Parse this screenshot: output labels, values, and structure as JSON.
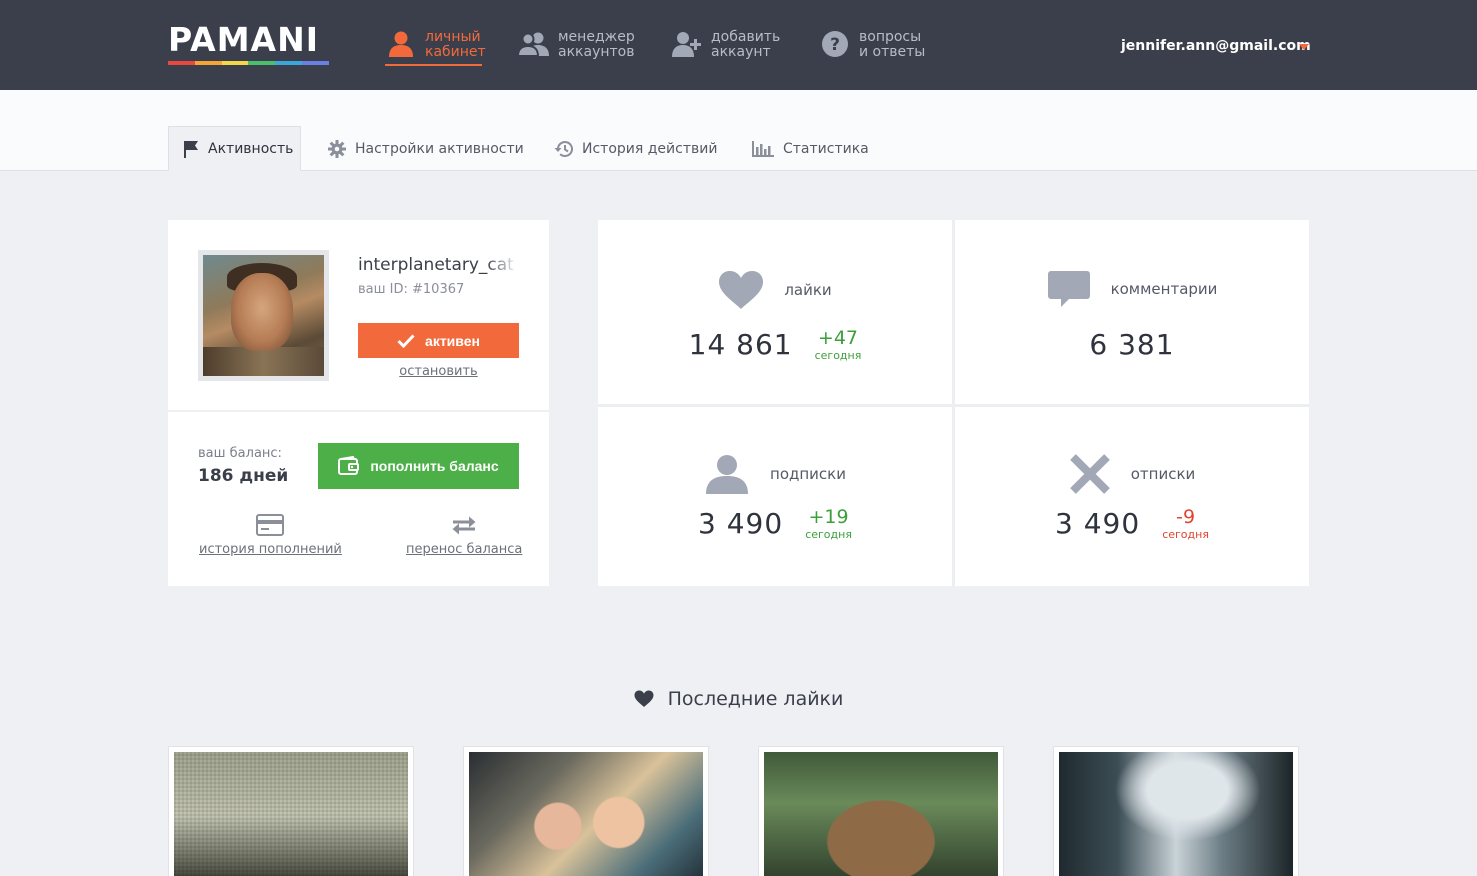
{
  "header": {
    "logo": "PAMANI",
    "logo_colors": [
      "#e9483f",
      "#f4a533",
      "#f5d84a",
      "#4cbf6a",
      "#3aa6d9",
      "#6c7ee1"
    ],
    "nav": [
      {
        "line1": "личный",
        "line2": "кабинет",
        "icon": "user-icon",
        "active": true
      },
      {
        "line1": "менеджер",
        "line2": "аккаунтов",
        "icon": "users-icon",
        "active": false
      },
      {
        "line1": "добавить",
        "line2": "аккаунт",
        "icon": "add-user-icon",
        "active": false
      },
      {
        "line1": "вопросы",
        "line2": "и ответы",
        "icon": "question-icon",
        "active": false
      }
    ],
    "user_email": "jennifer.ann@gmail.com",
    "accent": "#f26a3c",
    "bg": "#3b3f4b"
  },
  "tabs": [
    {
      "label": "Активность",
      "icon": "flag-icon",
      "active": true
    },
    {
      "label": "Настройки активности",
      "icon": "gear-icon",
      "active": false
    },
    {
      "label": "История действий",
      "icon": "history-icon",
      "active": false
    },
    {
      "label": "Статистика",
      "icon": "bar-chart-icon",
      "active": false
    }
  ],
  "profile": {
    "username": "interplanetary_cat",
    "user_id": "ваш ID: #10367",
    "status_button": "активен",
    "stop_link": "остановить",
    "balance_label": "ваш баланс:",
    "balance_value": "186 дней",
    "topup_button": "пополнить баланс",
    "history_link": "история пополнений",
    "transfer_link": "перенос баланса"
  },
  "stats": {
    "likes": {
      "label": "лайки",
      "value": "14 861",
      "delta": "+47",
      "delta_label": "сегодня"
    },
    "comments": {
      "label": "комментарии",
      "value": "6 381"
    },
    "follows": {
      "label": "подписки",
      "value": "3 490",
      "delta": "+19",
      "delta_label": "сегодня"
    },
    "unfollows": {
      "label": "отписки",
      "value": "3 490",
      "delta": "-9",
      "delta_label": "сегодня"
    }
  },
  "recent_likes": {
    "title": "Последние лайки"
  },
  "colors": {
    "positive": "#3c9f3a",
    "negative": "#e0442d",
    "success_button": "#4caf47",
    "icon_gray": "#a3a8b6"
  }
}
